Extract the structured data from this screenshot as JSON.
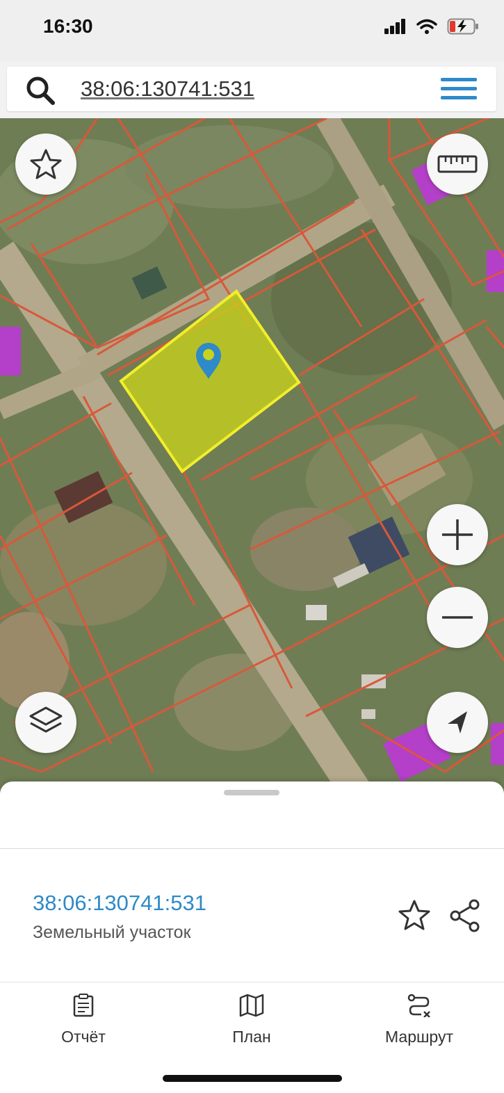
{
  "status_bar": {
    "time": "16:30",
    "icons": [
      "signal-icon",
      "wifi-icon",
      "battery-charging-icon"
    ]
  },
  "search": {
    "value": "38:06:130741:531"
  },
  "map": {
    "buttons": [
      "star-icon",
      "ruler-icon",
      "zoom-in-icon",
      "zoom-out-icon",
      "layers-icon",
      "location-arrow-icon"
    ],
    "colors": {
      "parcel_border": "#d9583a",
      "selected_fill": "#c9d21c",
      "selected_border": "#f2ee2a",
      "pin": "#2e8ac8",
      "roof_highlight": "#b43fc9"
    }
  },
  "sheet": {
    "parcel_id": "38:06:130741:531",
    "parcel_type": "Земельный участок",
    "actions": [
      "star-icon",
      "share-icon"
    ]
  },
  "bottom_nav": [
    {
      "label": "Отчёт",
      "icon": "report-icon"
    },
    {
      "label": "План",
      "icon": "map-icon"
    },
    {
      "label": "Маршрут",
      "icon": "route-icon"
    }
  ]
}
